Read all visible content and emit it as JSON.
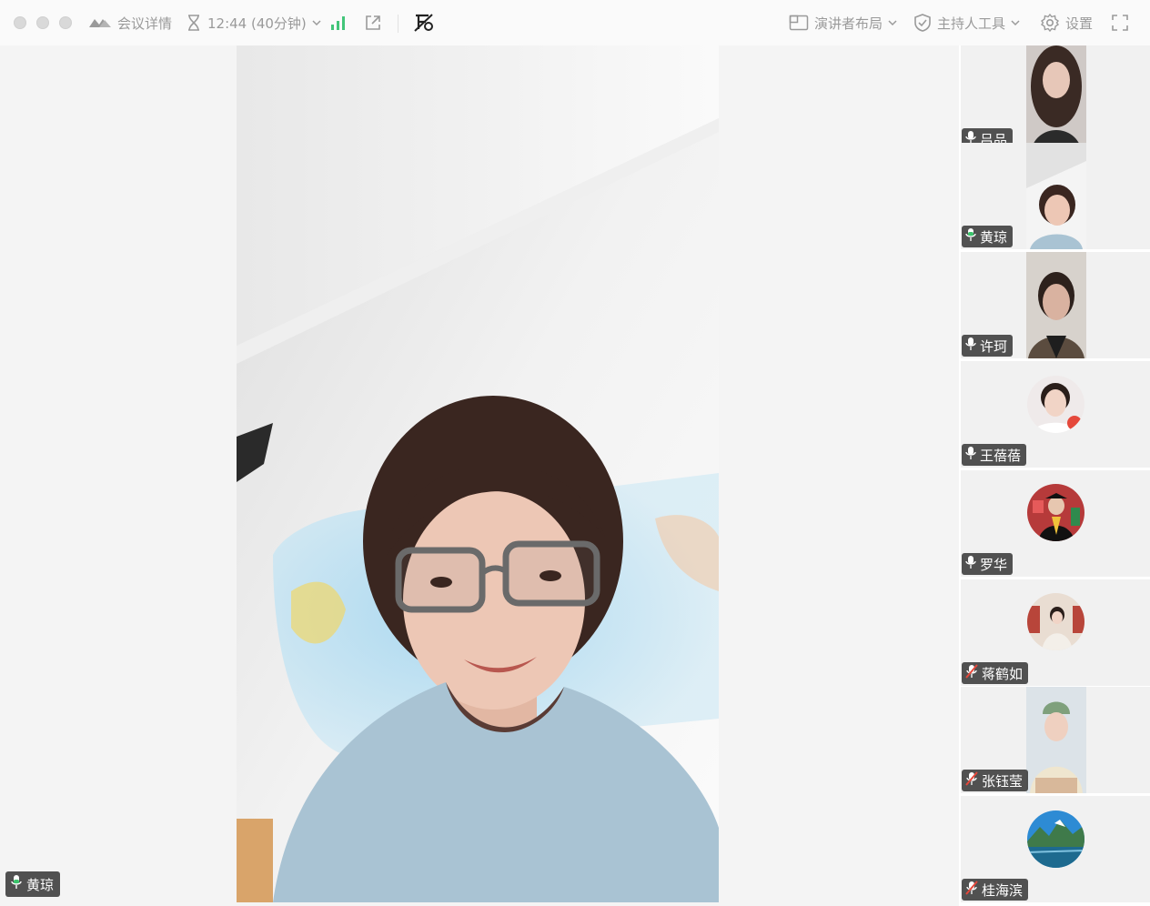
{
  "toolbar": {
    "meeting_details": "会议详情",
    "timer": "12:44 (40分钟)",
    "presenter_layout": "演讲者布局",
    "host_tools": "主持人工具",
    "settings": "设置"
  },
  "main_speaker": {
    "name": "黄琼",
    "mic": "on"
  },
  "participants": [
    {
      "name": "吕品",
      "mic": "on",
      "avatar": "video"
    },
    {
      "name": "黄琼",
      "mic": "active",
      "avatar": "video"
    },
    {
      "name": "许珂",
      "mic": "on",
      "avatar": "video"
    },
    {
      "name": "王蓓蓓",
      "mic": "on",
      "avatar": "circle"
    },
    {
      "name": "罗华",
      "mic": "on",
      "avatar": "circle"
    },
    {
      "name": "蒋鹤如",
      "mic": "muted",
      "avatar": "circle"
    },
    {
      "name": "张钰莹",
      "mic": "muted",
      "avatar": "video"
    },
    {
      "name": "桂海滨",
      "mic": "muted",
      "avatar": "circle"
    }
  ],
  "colors": {
    "mic_active": "#3ac46b",
    "mic_muted": "#e5483b",
    "accent_signal": "#43c57a"
  }
}
